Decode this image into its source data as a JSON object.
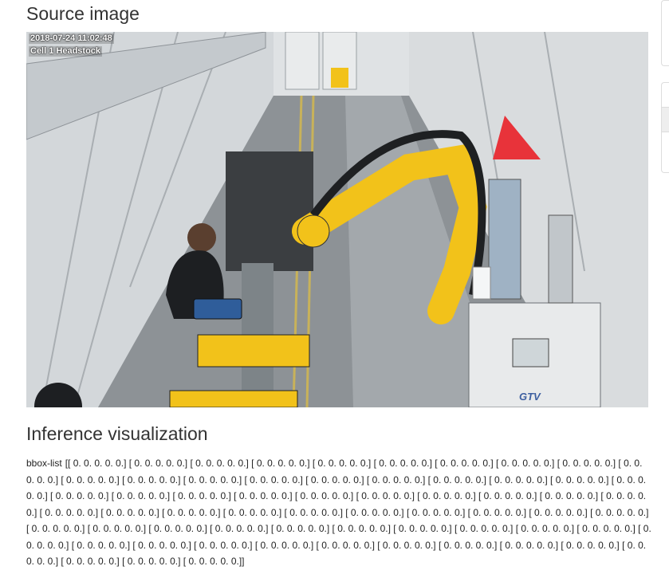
{
  "page": {
    "source_heading": "Source image",
    "inference_heading": "Inference visualization"
  },
  "camera": {
    "timestamp": "2018-07-24 11:02:48",
    "label": "Cell 1 Headstock",
    "machine_text": "GTV"
  },
  "bbox": {
    "label": "bbox-list",
    "value": "[[ 0. 0. 0. 0. 0.] [ 0. 0. 0. 0. 0.] [ 0. 0. 0. 0. 0.] [ 0. 0. 0. 0. 0.] [ 0. 0. 0. 0. 0.] [ 0. 0. 0. 0. 0.] [ 0. 0. 0. 0. 0.] [ 0. 0. 0. 0. 0.] [ 0. 0. 0. 0. 0.] [ 0. 0. 0. 0. 0.] [ 0. 0. 0. 0. 0.] [ 0. 0. 0. 0. 0.] [ 0. 0. 0. 0. 0.] [ 0. 0. 0. 0. 0.] [ 0. 0. 0. 0. 0.] [ 0. 0. 0. 0. 0.] [ 0. 0. 0. 0. 0.] [ 0. 0. 0. 0. 0.] [ 0. 0. 0. 0. 0.] [ 0. 0. 0. 0. 0.] [ 0. 0. 0. 0. 0.] [ 0. 0. 0. 0. 0.] [ 0. 0. 0. 0. 0.] [ 0. 0. 0. 0. 0.] [ 0. 0. 0. 0. 0.] [ 0. 0. 0. 0. 0.] [ 0. 0. 0. 0. 0.] [ 0. 0. 0. 0. 0.] [ 0. 0. 0. 0. 0.] [ 0. 0. 0. 0. 0.] [ 0. 0. 0. 0. 0.] [ 0. 0. 0. 0. 0.] [ 0. 0. 0. 0. 0.] [ 0. 0. 0. 0. 0.] [ 0. 0. 0. 0. 0.] [ 0. 0. 0. 0. 0.] [ 0. 0. 0. 0. 0.] [ 0. 0. 0. 0. 0.] [ 0. 0. 0. 0. 0.] [ 0. 0. 0. 0. 0.] [ 0. 0. 0. 0. 0.] [ 0. 0. 0. 0. 0.] [ 0. 0. 0. 0. 0.] [ 0. 0. 0. 0. 0.] [ 0. 0. 0. 0. 0.] [ 0. 0. 0. 0. 0.] [ 0. 0. 0. 0. 0.] [ 0. 0. 0. 0. 0.] [ 0. 0. 0. 0. 0.] [ 0. 0. 0. 0. 0.] [ 0. 0. 0. 0. 0.] [ 0. 0. 0. 0. 0.] [ 0. 0. 0. 0. 0.] [ 0. 0. 0. 0. 0.] [ 0. 0. 0. 0. 0.] [ 0. 0. 0. 0. 0.] [ 0. 0. 0. 0. 0.] [ 0. 0. 0. 0. 0.] [ 0. 0. 0. 0. 0.] [ 0. 0. 0. 0. 0.] [ 0. 0. 0. 0. 0.] [ 0. 0. 0. 0. 0.] [ 0. 0. 0. 0. 0.] [ 0. 0. 0. 0. 0.]]"
  },
  "colors": {
    "robot_yellow": "#f2c21a",
    "cone_red": "#e8333a",
    "wall_grey": "#c9cdd0",
    "floor_grey": "#8d9296"
  }
}
